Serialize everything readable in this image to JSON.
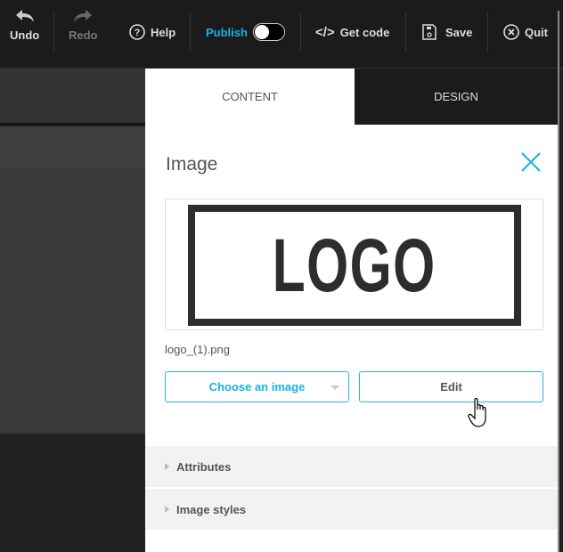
{
  "toolbar": {
    "undo": "Undo",
    "redo": "Redo",
    "help": "Help",
    "publish": "Publish",
    "publish_on": false,
    "get_code": "Get code",
    "save": "Save",
    "quit": "Quit"
  },
  "tabs": {
    "content": "CONTENT",
    "design": "DESIGN"
  },
  "panel": {
    "title": "Image",
    "logo_text": "LOGO",
    "filename": "logo_(1).png",
    "choose_label": "Choose an image",
    "edit_label": "Edit",
    "sections": [
      "Attributes",
      "Image styles"
    ]
  },
  "colors": {
    "accent": "#1ab0e0",
    "toolbar_bg": "#1b1b1b"
  }
}
